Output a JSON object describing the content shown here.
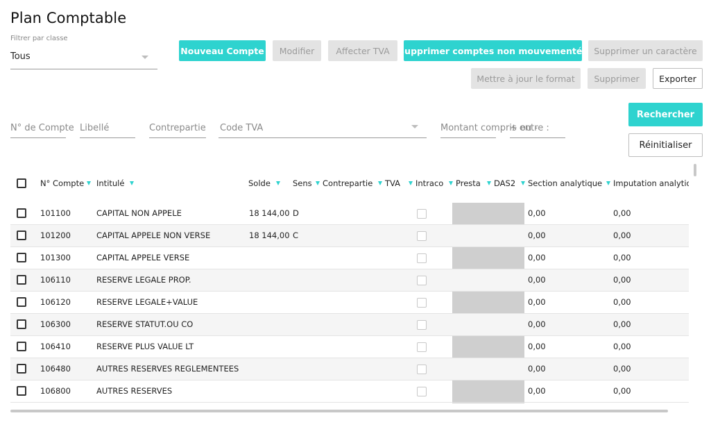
{
  "page": {
    "title": "Plan Comptable"
  },
  "filter": {
    "label": "Filtrer par classe",
    "value": "Tous"
  },
  "toolbar": {
    "new_account": "Nouveau Compte",
    "modify": "Modifier",
    "assign_vat": "Affecter TVA",
    "delete_unused": "Supprimer comptes non mouvementés",
    "delete_char": "Supprimer un caractère",
    "update_format": "Mettre à jour le format",
    "delete": "Supprimer",
    "export": "Exporter"
  },
  "search": {
    "account_no": "N° de Compte",
    "label": "Libellé",
    "counterpart": "Contrepartie",
    "vat_code": "Code TVA",
    "amount": "Montant compris entre :",
    "plus_minus": "+ ou -",
    "search_btn": "Rechercher",
    "reset_btn": "Réinitialiser"
  },
  "table": {
    "columns": {
      "account_no": "N° Compte",
      "title": "Intitulé",
      "balance": "Solde",
      "direction": "Sens",
      "counterpart": "Contrepartie",
      "vat": "TVA",
      "intracom": "Intraco",
      "presta": "Presta",
      "das2": "DAS2",
      "analytic_section": "Section analytique",
      "analytic_imputation": "Imputation analytiq"
    },
    "rows": [
      {
        "account": "101100",
        "title": "CAPITAL NON APPELE",
        "balance": "18 144,00",
        "direction": "D",
        "section": "0,00",
        "imputation": "0,00"
      },
      {
        "account": "101200",
        "title": "CAPITAL APPELE NON VERSE",
        "balance": "18 144,00",
        "direction": "C",
        "section": "0,00",
        "imputation": "0,00"
      },
      {
        "account": "101300",
        "title": "CAPITAL APPELE VERSE",
        "balance": "",
        "direction": "",
        "section": "0,00",
        "imputation": "0,00"
      },
      {
        "account": "106110",
        "title": "RESERVE LEGALE PROP.",
        "balance": "",
        "direction": "",
        "section": "0,00",
        "imputation": "0,00"
      },
      {
        "account": "106120",
        "title": "RESERVE LEGALE+VALUE",
        "balance": "",
        "direction": "",
        "section": "0,00",
        "imputation": "0,00"
      },
      {
        "account": "106300",
        "title": "RESERVE STATUT.OU CO",
        "balance": "",
        "direction": "",
        "section": "0,00",
        "imputation": "0,00"
      },
      {
        "account": "106410",
        "title": "RESERVE PLUS VALUE LT",
        "balance": "",
        "direction": "",
        "section": "0,00",
        "imputation": "0,00"
      },
      {
        "account": "106480",
        "title": "AUTRES RESERVES REGLEMENTEES",
        "balance": "",
        "direction": "",
        "section": "0,00",
        "imputation": "0,00"
      },
      {
        "account": "106800",
        "title": "AUTRES RESERVES",
        "balance": "",
        "direction": "",
        "section": "0,00",
        "imputation": "0,00"
      }
    ]
  },
  "colors": {
    "accent": "#2ed3cf",
    "disabled_bg": "#e3e3e3",
    "gray_column": "#cfcfcf"
  }
}
